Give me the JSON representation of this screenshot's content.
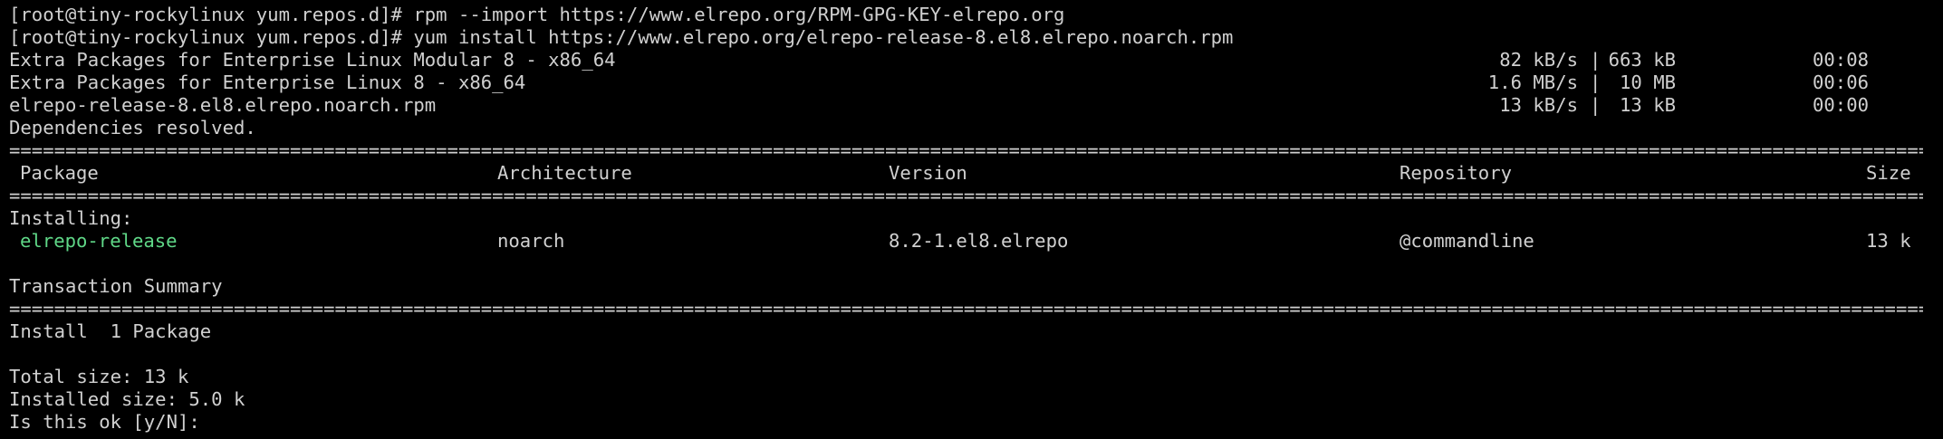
{
  "terminal": {
    "prompt_line_1": "[root@tiny-rockylinux yum.repos.d]# rpm --import https://www.elrepo.org/RPM-GPG-KEY-elrepo.org",
    "prompt_line_2": "[root@tiny-rockylinux yum.repos.d]# yum install https://www.elrepo.org/elrepo-release-8.el8.elrepo.noarch.rpm",
    "downloads": [
      {
        "name": "Extra Packages for Enterprise Linux Modular 8 - x86_64",
        "speed": "82 kB/s",
        "sep": "|",
        "size": "663 kB",
        "time": "00:08"
      },
      {
        "name": "Extra Packages for Enterprise Linux 8 - x86_64",
        "speed": "1.6 MB/s",
        "sep": "|",
        "size": "10 MB",
        "time": "00:06"
      },
      {
        "name": "elrepo-release-8.el8.elrepo.noarch.rpm",
        "speed": "13 kB/s",
        "sep": "|",
        "size": "13 kB",
        "time": "00:00"
      }
    ],
    "deps_resolved": "Dependencies resolved.",
    "rule_char": "=",
    "table_headers": {
      "package": "Package",
      "architecture": "Architecture",
      "version": "Version",
      "repository": "Repository",
      "size": "Size"
    },
    "installing_label": "Installing:",
    "package_row": {
      "package": "elrepo-release",
      "architecture": "noarch",
      "version": "8.2-1.el8.elrepo",
      "repository": "@commandline",
      "size": "13 k"
    },
    "transaction_summary": "Transaction Summary",
    "install_count": "Install  1 Package",
    "total_size": "Total size: 13 k",
    "installed_size": "Installed size: 5.0 k",
    "confirm_prompt": "Is this ok [y/N]:",
    "colors": {
      "background": "#000000",
      "text": "#d0d0d0",
      "package_highlight": "#5fd787"
    }
  }
}
